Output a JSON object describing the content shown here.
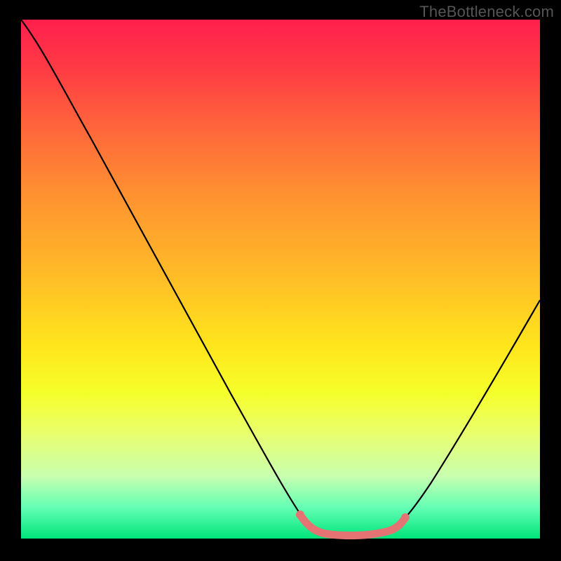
{
  "attribution": "TheBottleneck.com",
  "chart_data": {
    "type": "line",
    "title": "",
    "xlabel": "",
    "ylabel": "",
    "xlim": [
      0,
      100
    ],
    "ylim": [
      0,
      100
    ],
    "curve_points": [
      {
        "x": 0,
        "y": 100
      },
      {
        "x": 8,
        "y": 92
      },
      {
        "x": 16,
        "y": 78
      },
      {
        "x": 24,
        "y": 63
      },
      {
        "x": 32,
        "y": 48
      },
      {
        "x": 40,
        "y": 33
      },
      {
        "x": 48,
        "y": 17
      },
      {
        "x": 53,
        "y": 6
      },
      {
        "x": 56,
        "y": 2
      },
      {
        "x": 60,
        "y": 1
      },
      {
        "x": 66,
        "y": 1
      },
      {
        "x": 70,
        "y": 2
      },
      {
        "x": 73,
        "y": 5
      },
      {
        "x": 78,
        "y": 12
      },
      {
        "x": 84,
        "y": 22
      },
      {
        "x": 90,
        "y": 34
      },
      {
        "x": 96,
        "y": 46
      },
      {
        "x": 100,
        "y": 55
      }
    ],
    "highlight_band": {
      "x_start": 53,
      "x_end": 73,
      "color": "#e57373"
    },
    "gradient_stops": [
      {
        "pos": 0.0,
        "color": "#ff1f4d"
      },
      {
        "pos": 0.63,
        "color": "#ffe61c"
      },
      {
        "pos": 1.0,
        "color": "#00e47a"
      }
    ]
  }
}
